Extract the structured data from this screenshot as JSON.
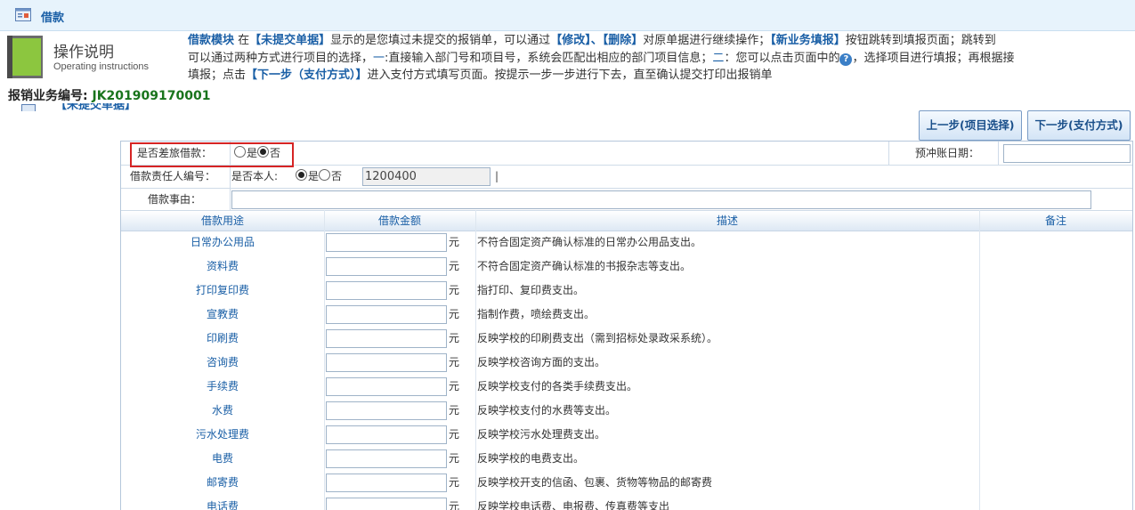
{
  "window": {
    "title": "借款"
  },
  "instructions": {
    "title": "操作说明",
    "subtitle": "Operating instructions",
    "line1": [
      {
        "t": "借款模块",
        "c": "b"
      },
      {
        "t": " 在",
        "c": ""
      },
      {
        "t": "【未提交单据】",
        "c": "b"
      },
      {
        "t": "显示的是您填过未提交的报销单，可以通过",
        "c": ""
      },
      {
        "t": "【修改】、【删除】",
        "c": "b"
      },
      {
        "t": "对原单据进行继续操作；",
        "c": ""
      },
      {
        "t": "【新业务填报】",
        "c": "b"
      },
      {
        "t": "按钮跳转到填报页面；跳转到",
        "c": ""
      }
    ],
    "line2": [
      {
        "t": "可以通过两种方式进行项目的选择，",
        "c": ""
      },
      {
        "t": "一",
        "c": "bl"
      },
      {
        "t": ":直接输入部门号和项目号，系统会匹配出相应的部门项目信息；",
        "c": ""
      },
      {
        "t": "二",
        "c": "bl"
      },
      {
        "t": "：您可以点击页面中的",
        "c": ""
      },
      {
        "t": "?",
        "c": "icon"
      },
      {
        "t": "，选择项目进行填报；再根据接",
        "c": ""
      }
    ],
    "line3": [
      {
        "t": "填报；点击",
        "c": ""
      },
      {
        "t": "【下一步（支付方式）】",
        "c": "b"
      },
      {
        "t": "进入支付方式填写页面。按提示一步一步进行下去，直至确认提交打印出报销单",
        "c": ""
      }
    ]
  },
  "business_no": {
    "label": "报销业务编号:",
    "value": "JK201909170001"
  },
  "partial_section_label": "【未提交单据】",
  "buttons": {
    "prev": "上一步(项目选择)",
    "next": "下一步(支付方式)"
  },
  "form": {
    "travel_loan_label": "是否差旅借款：",
    "yes": "是",
    "no": "否",
    "travel_loan_value": "否",
    "offset_date_label": "预冲账日期：",
    "offset_date_value": "",
    "person_id_label": "借款责任人编号：",
    "self_label": "是否本人:",
    "self_value": "是",
    "person_id_value": "1200400",
    "person_id_suffix": "|",
    "reason_label": "借款事由：",
    "reason_value": ""
  },
  "grid": {
    "headers": [
      "借款用途",
      "借款金额",
      "描述",
      "备注"
    ],
    "unit": "元",
    "rows": [
      {
        "category": "日常办公用品",
        "desc": "不符合固定资产确认标准的日常办公用品支出。"
      },
      {
        "category": "资料费",
        "desc": "不符合固定资产确认标准的书报杂志等支出。"
      },
      {
        "category": "打印复印费",
        "desc": "指打印、复印费支出。"
      },
      {
        "category": "宣教费",
        "desc": "指制作费，喷绘费支出。"
      },
      {
        "category": "印刷费",
        "desc": "反映学校的印刷费支出（需到招标处录政采系统）。"
      },
      {
        "category": "咨询费",
        "desc": "反映学校咨询方面的支出。"
      },
      {
        "category": "手续费",
        "desc": "反映学校支付的各类手续费支出。"
      },
      {
        "category": "水费",
        "desc": "反映学校支付的水费等支出。"
      },
      {
        "category": "污水处理费",
        "desc": "反映学校污水处理费支出。"
      },
      {
        "category": "电费",
        "desc": "反映学校的电费支出。"
      },
      {
        "category": "邮寄费",
        "desc": "反映学校开支的信函、包裹、货物等物品的邮寄费"
      },
      {
        "category": "电话费",
        "desc": "反映学校电话费、电报费、传真费等支出"
      }
    ]
  },
  "colors": {
    "accent": "#1a5fa6",
    "highlight_box": "#d62424",
    "business_no": "#19741c"
  }
}
